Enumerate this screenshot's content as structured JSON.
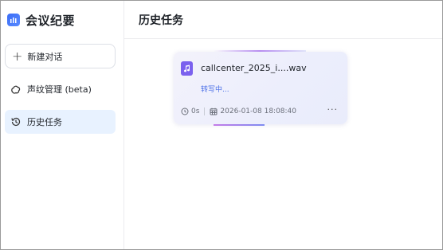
{
  "app": {
    "title": "会议纪要"
  },
  "sidebar": {
    "new_chat_label": "新建对话",
    "items": [
      {
        "label": "声纹管理 (beta)",
        "icon": "voiceprint-icon"
      },
      {
        "label": "历史任务",
        "icon": "history-icon",
        "active": true
      }
    ]
  },
  "main": {
    "title": "历史任务",
    "tasks": [
      {
        "file_name": "callcenter_2025_i....wav",
        "status": "转写中...",
        "duration": "0s",
        "created_at": "2026-01-08 18:08:40",
        "more": "···"
      }
    ]
  },
  "colors": {
    "accent": "#3a6cf6",
    "active_bg": "#e8f2ff",
    "file_icon": "#7b61ee",
    "status": "#4b6fe8"
  }
}
